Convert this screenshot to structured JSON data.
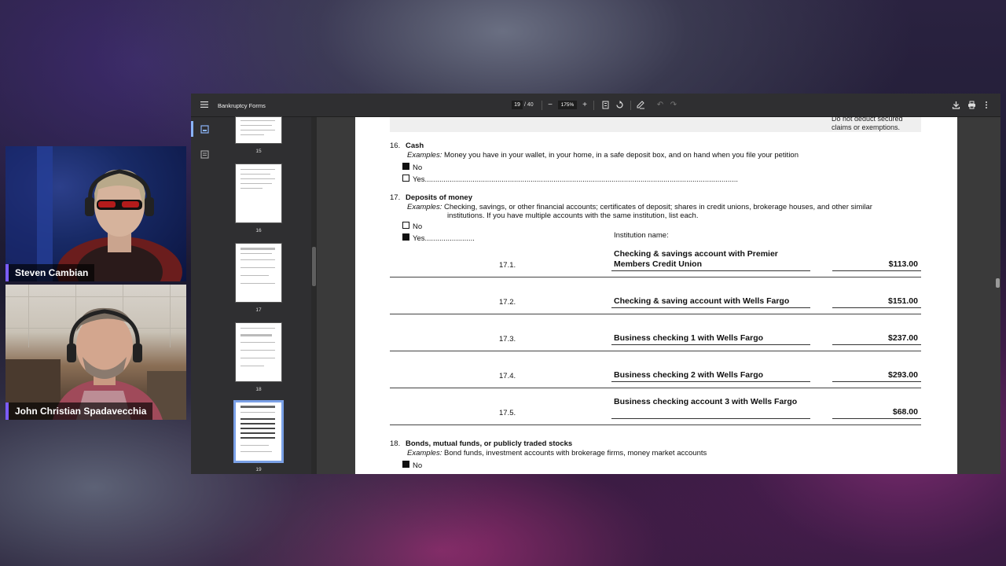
{
  "participants": [
    {
      "name": "Steven Cambian"
    },
    {
      "name": "John Christian Spadavecchia"
    }
  ],
  "viewer": {
    "title": "Bankruptcy Forms",
    "current_page": "19",
    "total_pages": "/ 40",
    "zoom": "175%",
    "icons": [
      "menu-icon",
      "zoom-out-icon",
      "zoom-in-icon",
      "fit-page-icon",
      "rotate-icon",
      "annotate-icon",
      "undo-icon",
      "redo-icon",
      "download-icon",
      "print-icon",
      "more-icon"
    ]
  },
  "thumbnails": [
    {
      "label": "15"
    },
    {
      "label": "16"
    },
    {
      "label": "17"
    },
    {
      "label": "18"
    },
    {
      "label": "19"
    }
  ],
  "form": {
    "top_note": "Do not deduct secured\nclaims or exemptions.",
    "cash": {
      "number": "16.",
      "title": "Cash",
      "examples_label": "Examples:",
      "examples_text": " Money you have in your wallet, in your home, in a safe deposit box, and on hand when you file your petition",
      "no": "No",
      "yes": "Yes......................................................................................................................................................."
    },
    "deposits": {
      "number": "17.",
      "title": "Deposits of money",
      "examples_label": "Examples:",
      "examples_text": " Checking, savings, or other financial accounts; certificates of deposit; shares in credit unions, brokerage houses, and other similar",
      "examples_cont": "institutions. If you have multiple accounts with the same institution, list each.",
      "no": "No",
      "yes": "Yes........................",
      "institution_label": "Institution name:",
      "accounts": [
        {
          "no": "17.1.",
          "name": "Checking & savings account with Premier Members Credit Union",
          "amount": "$113.00"
        },
        {
          "no": "17.2.",
          "name": "Checking & saving account with Wells Fargo",
          "amount": "$151.00"
        },
        {
          "no": "17.3.",
          "name": "Business checking 1 with Wells Fargo",
          "amount": "$237.00"
        },
        {
          "no": "17.4.",
          "name": "Business checking 2 with Wells Fargo",
          "amount": "$293.00"
        },
        {
          "no": "17.5.",
          "name": "Business checking account 3 with Wells Fargo",
          "amount": "$68.00"
        }
      ]
    },
    "bonds": {
      "number": "18.",
      "title": "Bonds, mutual funds, or publicly traded stocks",
      "examples_label": "Examples:",
      "examples_text": " Bond funds, investment accounts with brokerage firms, money market accounts",
      "no": "No"
    }
  }
}
